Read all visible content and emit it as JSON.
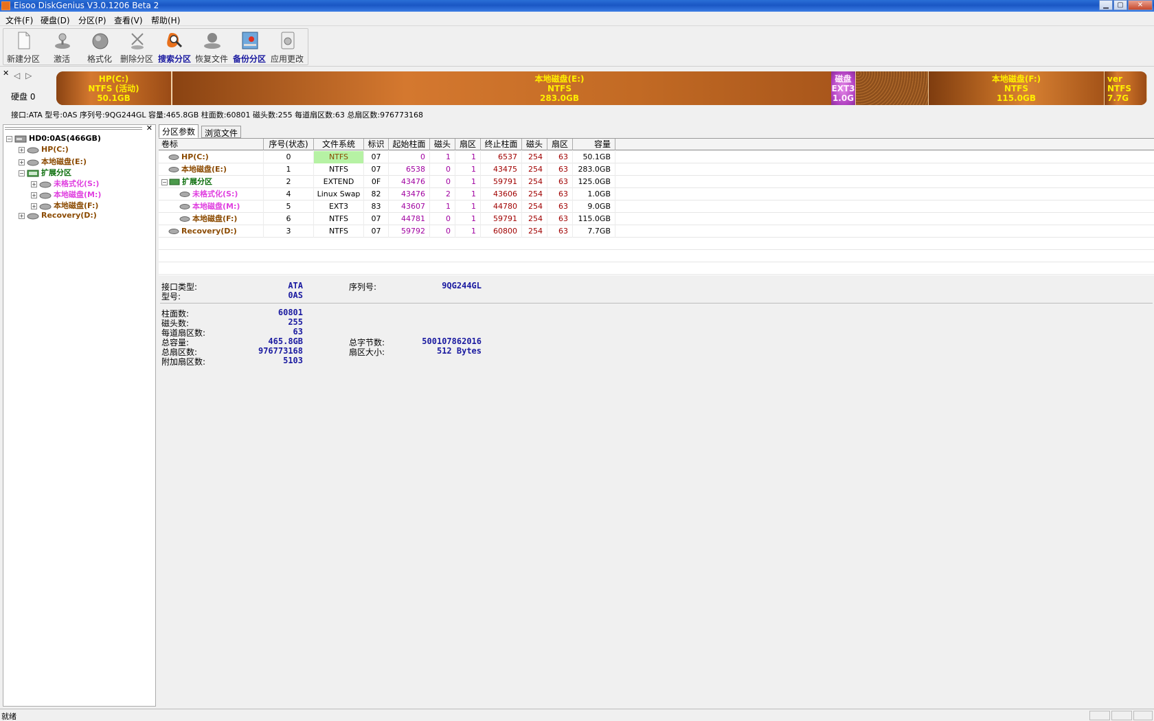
{
  "window": {
    "title": "Eisoo DiskGenius V3.0.1206 Beta 2"
  },
  "menu": [
    "文件(F)",
    "硬盘(D)",
    "分区(P)",
    "查看(V)",
    "帮助(H)"
  ],
  "toolbar": [
    {
      "label": "新建分区",
      "icon": "new-partition-icon"
    },
    {
      "label": "激活",
      "icon": "activate-icon"
    },
    {
      "label": "格式化",
      "icon": "format-icon"
    },
    {
      "label": "删除分区",
      "icon": "delete-partition-icon"
    },
    {
      "label": "搜索分区",
      "icon": "search-partition-icon"
    },
    {
      "label": "恢复文件",
      "icon": "recover-files-icon"
    },
    {
      "label": "备份分区",
      "icon": "backup-partition-icon"
    },
    {
      "label": "应用更改",
      "icon": "apply-changes-icon"
    }
  ],
  "disk": {
    "label": "硬盘 0",
    "info": "接口:ATA  型号:0AS  序列号:9QG244GL  容量:465.8GB  柱面数:60801  磁头数:255  每道扇区数:63  总扇区数:976773168",
    "segments": [
      {
        "l1": "HP(C:)",
        "l2": "NTFS (活动)",
        "l3": "50.1GB"
      },
      {
        "l1": "本地磁盘(E:)",
        "l2": "NTFS",
        "l3": "283.0GB"
      },
      {
        "l1": "磁盘",
        "l2": "EXT3",
        "l3": "1.0G"
      },
      {
        "l1": "本地磁盘(F:)",
        "l2": "NTFS",
        "l3": "115.0GB"
      },
      {
        "l1": "ver",
        "l2": "NTFS",
        "l3": "7.7G"
      }
    ]
  },
  "tree": {
    "root": "HD0:0AS(466GB)",
    "items": [
      {
        "label": "HP(C:)",
        "color": "brown"
      },
      {
        "label": "本地磁盘(E:)",
        "color": "brown"
      },
      {
        "label": "扩展分区",
        "color": "green"
      },
      {
        "label": "未格式化(S:)",
        "color": "pink"
      },
      {
        "label": "本地磁盘(M:)",
        "color": "pink"
      },
      {
        "label": "本地磁盘(F:)",
        "color": "brown"
      },
      {
        "label": "Recovery(D:)",
        "color": "brown"
      }
    ]
  },
  "tabs": [
    "分区参数",
    "浏览文件"
  ],
  "table": {
    "headers": [
      "卷标",
      "序号(状态)",
      "文件系统",
      "标识",
      "起始柱面",
      "磁头",
      "扇区",
      "终止柱面",
      "磁头",
      "扇区",
      "容量"
    ],
    "rows": [
      [
        "HP(C:)",
        "0",
        "NTFS",
        "07",
        "0",
        "1",
        "1",
        "6537",
        "254",
        "63",
        "50.1GB"
      ],
      [
        "本地磁盘(E:)",
        "1",
        "NTFS",
        "07",
        "6538",
        "0",
        "1",
        "43475",
        "254",
        "63",
        "283.0GB"
      ],
      [
        "扩展分区",
        "2",
        "EXTEND",
        "0F",
        "43476",
        "0",
        "1",
        "59791",
        "254",
        "63",
        "125.0GB"
      ],
      [
        "未格式化(S:)",
        "4",
        "Linux Swap",
        "82",
        "43476",
        "2",
        "1",
        "43606",
        "254",
        "63",
        "1.0GB"
      ],
      [
        "本地磁盘(M:)",
        "5",
        "EXT3",
        "83",
        "43607",
        "1",
        "1",
        "44780",
        "254",
        "63",
        "9.0GB"
      ],
      [
        "本地磁盘(F:)",
        "6",
        "NTFS",
        "07",
        "44781",
        "0",
        "1",
        "59791",
        "254",
        "63",
        "115.0GB"
      ],
      [
        "Recovery(D:)",
        "3",
        "NTFS",
        "07",
        "59792",
        "0",
        "1",
        "60800",
        "254",
        "63",
        "7.7GB"
      ]
    ]
  },
  "details": {
    "iface_label": "接口类型:",
    "iface": "ATA",
    "serial_label": "序列号:",
    "serial": "9QG244GL",
    "model_label": "型号:",
    "model": "0AS",
    "cyl_label": "柱面数:",
    "cyl": "60801",
    "heads_label": "磁头数:",
    "heads": "255",
    "spt_label": "每道扇区数:",
    "spt": "63",
    "cap_label": "总容量:",
    "cap": "465.8GB",
    "bytes_label": "总字节数:",
    "bytes": "500107862016",
    "sectors_label": "总扇区数:",
    "sectors": "976773168",
    "secsize_label": "扇区大小:",
    "secsize": "512 Bytes",
    "extra_label": "附加扇区数:",
    "extra": "5103"
  },
  "status": "就绪"
}
